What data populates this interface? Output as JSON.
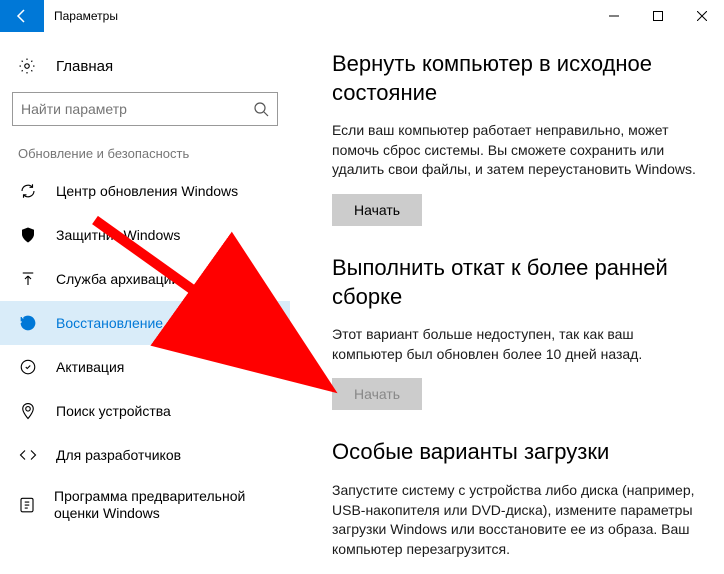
{
  "titlebar": {
    "title": "Параметры"
  },
  "sidebar": {
    "home_label": "Главная",
    "search_placeholder": "Найти параметр",
    "group_header": "Обновление и безопасность",
    "items": [
      {
        "label": "Центр обновления Windows"
      },
      {
        "label": "Защитник Windows"
      },
      {
        "label": "Служба архивации"
      },
      {
        "label": "Восстановление"
      },
      {
        "label": "Активация"
      },
      {
        "label": "Поиск устройства"
      },
      {
        "label": "Для разработчиков"
      },
      {
        "label": "Программа предварительной оценки Windows"
      }
    ]
  },
  "content": {
    "sections": [
      {
        "title": "Вернуть компьютер в исходное состояние",
        "desc": "Если ваш компьютер работает неправильно, может помочь сброс системы. Вы сможете сохранить или удалить свои файлы, и затем переустановить Windows.",
        "button": "Начать"
      },
      {
        "title": "Выполнить откат к более ранней сборке",
        "desc": "Этот вариант больше недоступен, так как ваш компьютер был обновлен более 10 дней назад.",
        "button": "Начать"
      },
      {
        "title": "Особые варианты загрузки",
        "desc": "Запустите систему с устройства либо диска (например, USB-накопителя или DVD-диска), измените параметры загрузки Windows или восстановите ее из образа. Ваш компьютер перезагрузится."
      }
    ]
  }
}
